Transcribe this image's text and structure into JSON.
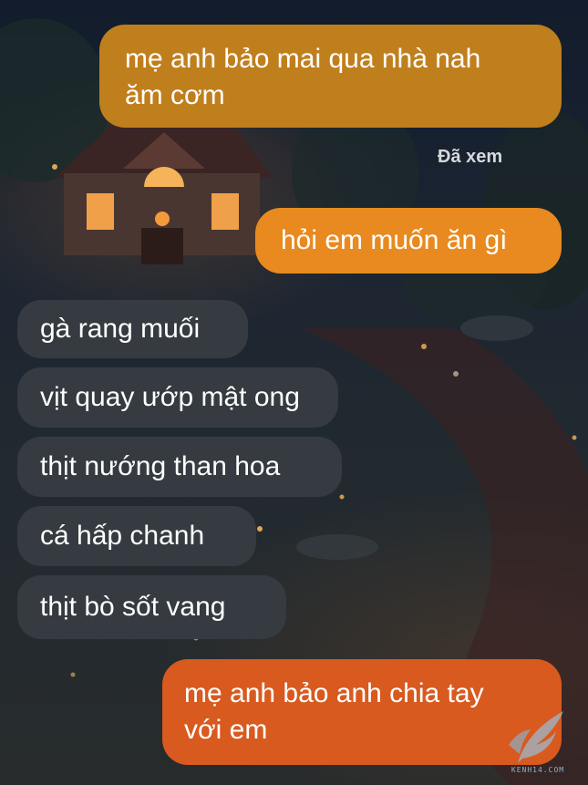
{
  "messages": [
    {
      "id": "m1",
      "side": "outgoing",
      "text": "mẹ anh bảo mai qua nhà nah\năm cơm"
    },
    {
      "id": "m2",
      "side": "outgoing",
      "text": "hỏi em muốn ăn gì"
    },
    {
      "id": "m3",
      "side": "incoming",
      "text": "gà rang muối"
    },
    {
      "id": "m4",
      "side": "incoming",
      "text": "vịt quay ướp mật ong"
    },
    {
      "id": "m5",
      "side": "incoming",
      "text": "thịt nướng than hoa"
    },
    {
      "id": "m6",
      "side": "incoming",
      "text": "cá hấp chanh"
    },
    {
      "id": "m7",
      "side": "incoming",
      "text": "thịt bò sốt vang"
    },
    {
      "id": "m8",
      "side": "outgoing",
      "text": "mẹ anh bảo anh chia tay\nvới em"
    }
  ],
  "read_receipt": "Đã xem",
  "watermark": {
    "text": "KENH14.COM"
  },
  "colors": {
    "bubble_1": "#c07f1d",
    "bubble_2": "#e88a1f",
    "bubble_last": "#d85a1f",
    "incoming": "#353b40"
  }
}
